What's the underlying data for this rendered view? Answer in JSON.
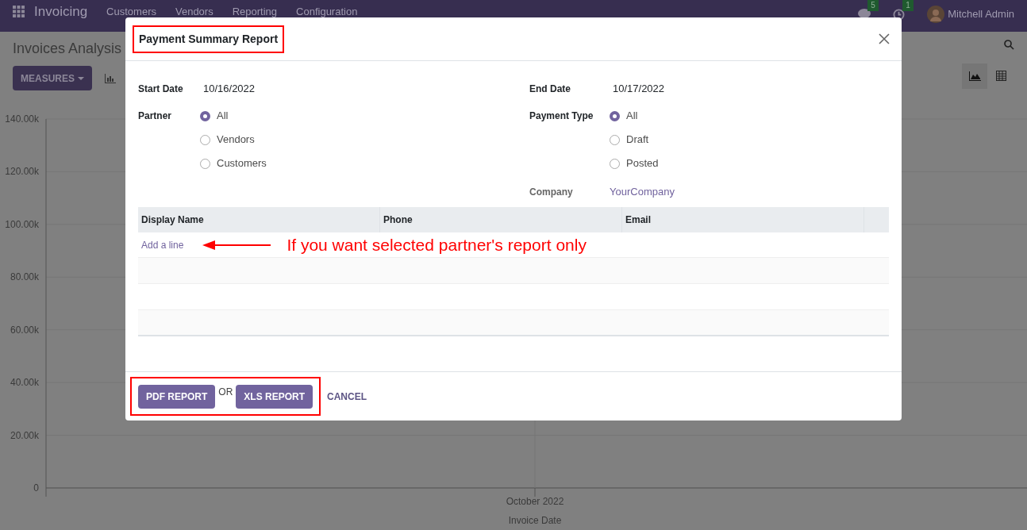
{
  "navbar": {
    "app_name": "Invoicing",
    "menu": [
      "Customers",
      "Vendors",
      "Reporting",
      "Configuration"
    ],
    "messages_count": "5",
    "activities_count": "1",
    "user_name": "Mitchell Admin"
  },
  "page": {
    "title": "Invoices Analysis",
    "measures_button": "MEASURES",
    "chart_data": {
      "type": "bar",
      "xlabel": "Invoice Date",
      "categories": [
        "October 2022"
      ],
      "values": [
        null
      ],
      "ylim": [
        0,
        140000
      ],
      "grid": true,
      "yticks": [
        {
          "value": 0,
          "label": "0"
        },
        {
          "value": 20000,
          "label": "20.00k"
        },
        {
          "value": 40000,
          "label": "40.00k"
        },
        {
          "value": 60000,
          "label": "60.00k"
        },
        {
          "value": 80000,
          "label": "80.00k"
        },
        {
          "value": 100000,
          "label": "100.00k"
        },
        {
          "value": 120000,
          "label": "120.00k"
        },
        {
          "value": 140000,
          "label": "140.00k"
        }
      ]
    }
  },
  "dialog": {
    "title": "Payment Summary Report",
    "start_date": {
      "label": "Start Date",
      "value": "10/16/2022"
    },
    "end_date": {
      "label": "End Date",
      "value": "10/17/2022"
    },
    "partner": {
      "label": "Partner",
      "options": [
        {
          "label": "All",
          "selected": true
        },
        {
          "label": "Vendors",
          "selected": false
        },
        {
          "label": "Customers",
          "selected": false
        }
      ]
    },
    "payment_type": {
      "label": "Payment Type",
      "options": [
        {
          "label": "All",
          "selected": true
        },
        {
          "label": "Draft",
          "selected": false
        },
        {
          "label": "Posted",
          "selected": false
        }
      ]
    },
    "company": {
      "label": "Company",
      "value": "YourCompany"
    },
    "table": {
      "columns": [
        "Display Name",
        "Phone",
        "Email"
      ],
      "add_line": "Add a line"
    },
    "annotation": "If you want selected partner's report only",
    "pdf_button": "PDF REPORT",
    "or_text": "OR",
    "xls_button": "XLS REPORT",
    "cancel_button": "CANCEL"
  }
}
